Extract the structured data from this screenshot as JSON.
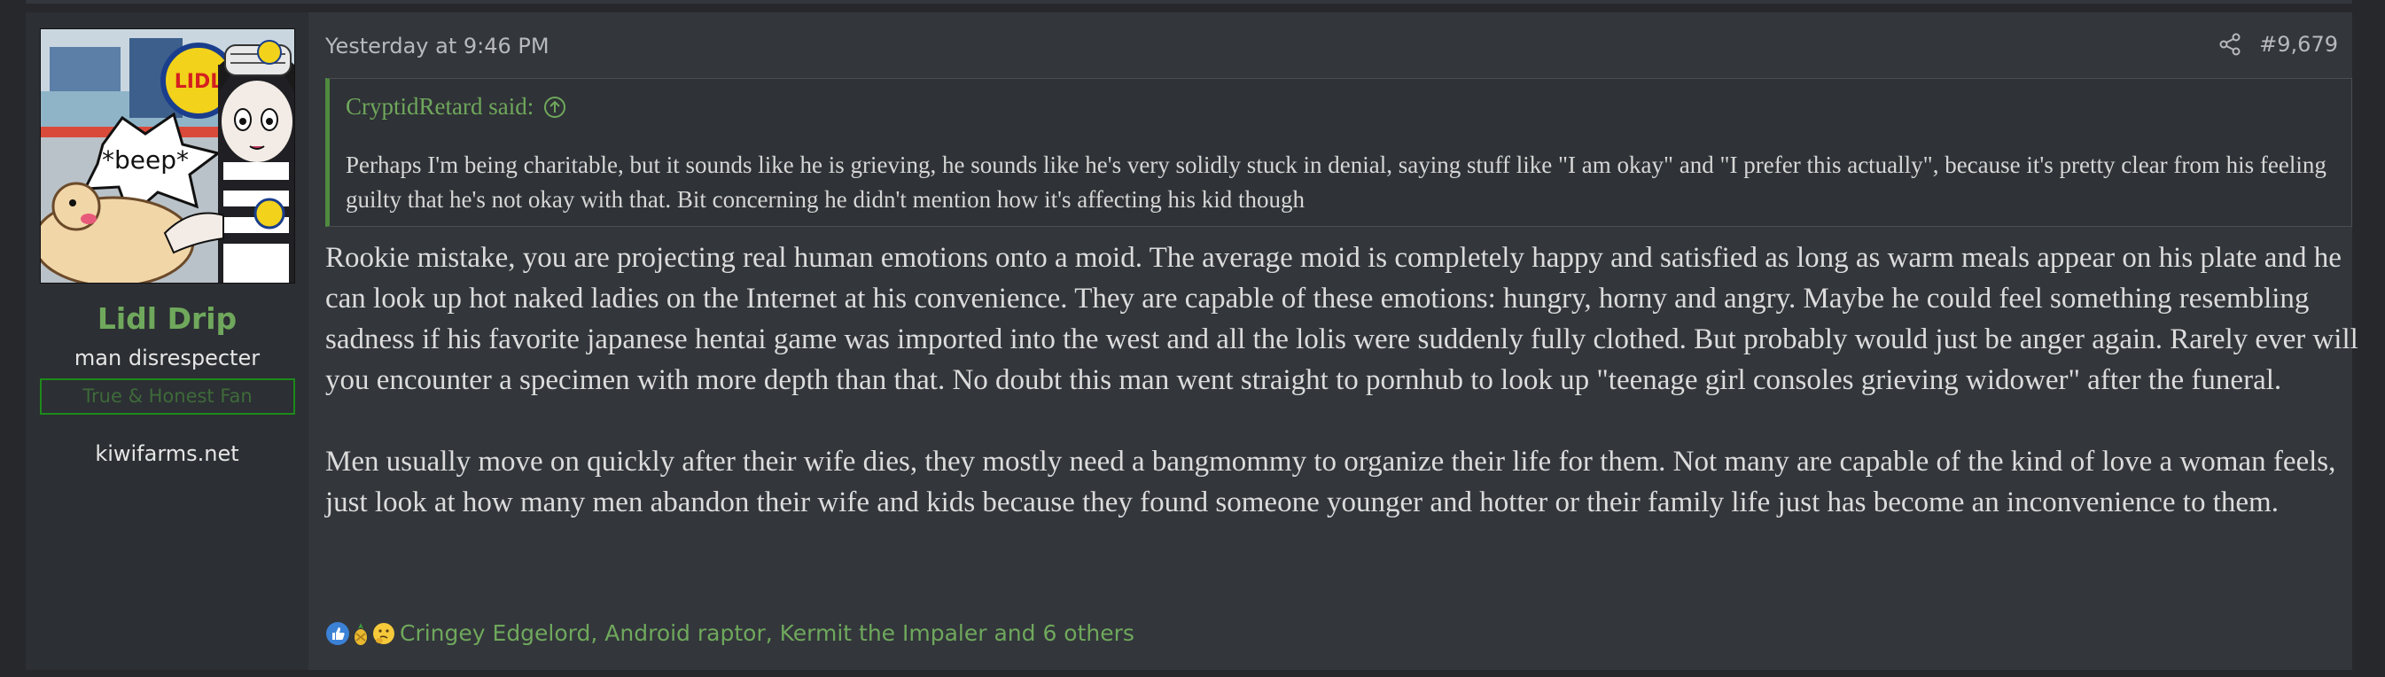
{
  "user": {
    "username": "Lidl Drip",
    "title": "man disrespecter",
    "banner": "True & Honest Fan",
    "site": "kiwifarms.net",
    "avatar_text": "*beep*",
    "avatar_logo": "LIDL"
  },
  "post": {
    "date": "Yesterday at 9:46 PM",
    "number": "#9,679",
    "share_icon": "share-icon"
  },
  "quote": {
    "author_line": "CryptidRetard said:",
    "text": "Perhaps I'm being charitable, but it sounds like he is grieving, he sounds like he's very solidly stuck in denial, saying stuff like \"I am okay\" and \"I prefer this actually\", because it's pretty clear from his feeling guilty that he's not okay with that. Bit concerning he didn't mention how it's affecting his kid though"
  },
  "body": {
    "paragraphs": [
      "Rookie mistake, you are projecting real human emotions onto a moid. The average moid is completely happy and satisfied as long as warm meals appear on his plate and he can look up hot naked ladies on the Internet at his convenience. They are capable of these emotions: hungry, horny and angry. Maybe he could feel something resembling sadness if his favorite japanese hentai game was imported into the west and all the lolis were suddenly fully clothed. But probably would just be anger again. Rarely ever will you encounter a specimen with more depth than that. No doubt this man went straight to pornhub to look up \"teenage girl consoles grieving widower\" after the funeral.",
      "Men usually move on quickly after their wife dies, they mostly need a bangmommy to organize their life for them. Not many are capable of the kind of love a woman feels, just look at how many men abandon their wife and kids because they found someone younger and hotter or their family life just has become an inconvenience to them."
    ]
  },
  "reactions": {
    "icons": [
      "thumbs-up-icon",
      "pineapple-icon",
      "thinking-face-icon"
    ],
    "text": "Cringey Edgelord, Android raptor, Kermit the Impaler and 6 others"
  },
  "colors": {
    "page_bg": "#26282c",
    "post_bg": "#33363b",
    "sidebar_bg": "#2c2f33",
    "accent_green": "#6fa85c",
    "banner_border": "#1c8a1c",
    "quote_border": "#4f8a3f"
  }
}
